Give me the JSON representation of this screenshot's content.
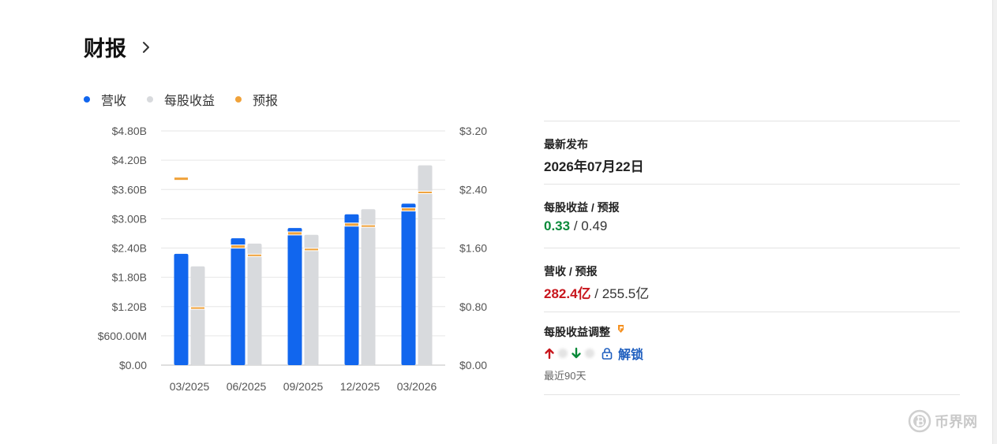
{
  "header": {
    "title": "财报"
  },
  "legend": [
    {
      "label": "营收",
      "color": "#1166ee"
    },
    {
      "label": "每股收益",
      "color": "#d8dadd"
    },
    {
      "label": "预报",
      "color": "#f0a23a"
    }
  ],
  "chart_data": {
    "type": "bar",
    "categories": [
      "03/2025",
      "06/2025",
      "09/2025",
      "12/2025",
      "03/2026"
    ],
    "series": [
      {
        "name": "营收",
        "axis": "left",
        "values": [
          2.28,
          2.6,
          2.81,
          3.09,
          3.31
        ],
        "color": "#1166ee"
      },
      {
        "name": "每股收益",
        "axis": "right",
        "values": [
          1.35,
          1.66,
          1.78,
          2.13,
          2.73
        ],
        "color": "#d8dadd"
      }
    ],
    "forecast": {
      "name": "预报",
      "color": "#f0a23a",
      "revenue": [
        3.82,
        2.43,
        2.7,
        2.88,
        3.19
      ],
      "eps": [
        0.78,
        1.5,
        1.58,
        1.9,
        2.36
      ]
    },
    "y_left": {
      "ylim": [
        0,
        4.8
      ],
      "ticks": [
        "$0.00",
        "$600.00M",
        "$1.20B",
        "$1.80B",
        "$2.40B",
        "$3.00B",
        "$3.60B",
        "$4.20B",
        "$4.80B"
      ]
    },
    "y_right": {
      "ylim": [
        0,
        3.2
      ],
      "ticks": [
        "$0.00",
        "$0.80",
        "$1.60",
        "$2.40",
        "$3.20"
      ]
    },
    "grid": true
  },
  "panel": {
    "latest_label": "最新发布",
    "latest_value": "2026年07月22日",
    "eps_label": "每股收益 / 预报",
    "eps_actual": "0.33",
    "eps_forecast": " / 0.49",
    "rev_label": "营收 / 预报",
    "rev_actual": "282.4亿",
    "rev_forecast": " / 255.5亿",
    "adj_label": "每股收益调整",
    "unlock_label": "解锁",
    "period_note": "最近90天"
  },
  "watermark": "币界网"
}
